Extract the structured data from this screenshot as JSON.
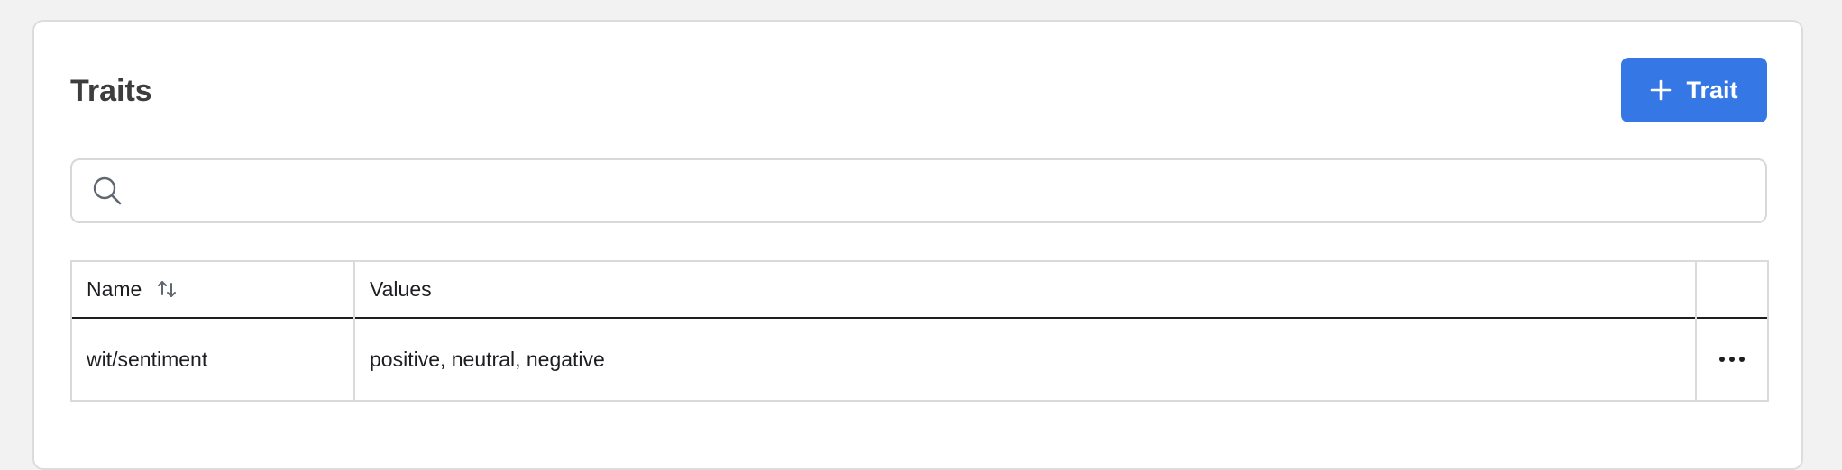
{
  "header": {
    "title": "Traits",
    "add_button_label": "Trait"
  },
  "search": {
    "value": "",
    "placeholder": ""
  },
  "table": {
    "columns": [
      {
        "label": "Name",
        "sortable": true
      },
      {
        "label": "Values",
        "sortable": false
      },
      {
        "label": "",
        "sortable": false
      }
    ],
    "rows": [
      {
        "name": "wit/sentiment",
        "values": "positive, neutral, negative"
      }
    ]
  },
  "icons": {
    "add": "plus-icon",
    "search": "search-icon",
    "sort": "sort-icon",
    "row_actions": "more-horizontal-icon"
  },
  "colors": {
    "accent": "#3578e5",
    "title": "#3d3d3d",
    "border": "#dadada"
  }
}
